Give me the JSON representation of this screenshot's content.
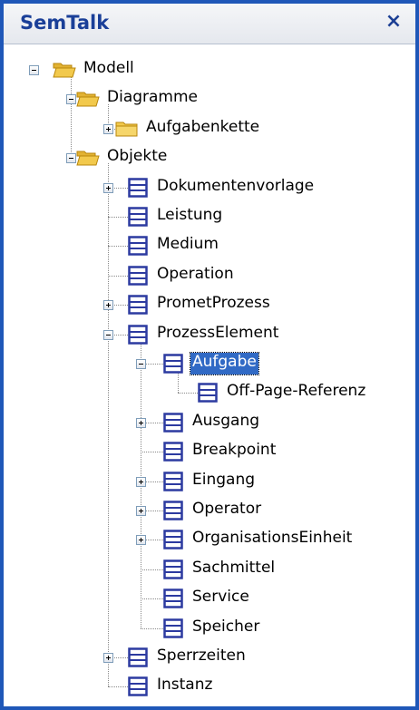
{
  "panel": {
    "title": "SemTalk",
    "close_glyph": "×"
  },
  "tree": {
    "nodes": [
      {
        "label": "Modell",
        "icon": "folder-open-icon",
        "expander": "minus"
      },
      {
        "label": "Diagramme",
        "icon": "folder-open-icon",
        "expander": "minus"
      },
      {
        "label": "Aufgabenkette",
        "icon": "folder-closed-icon",
        "expander": "plus"
      },
      {
        "label": "Objekte",
        "icon": "folder-open-icon",
        "expander": "minus"
      },
      {
        "label": "Dokumentenvorlage",
        "icon": "class-icon",
        "expander": "plus"
      },
      {
        "label": "Leistung",
        "icon": "class-icon",
        "expander": null
      },
      {
        "label": "Medium",
        "icon": "class-icon",
        "expander": null
      },
      {
        "label": "Operation",
        "icon": "class-icon",
        "expander": null
      },
      {
        "label": "PrometProzess",
        "icon": "class-icon",
        "expander": "plus"
      },
      {
        "label": "ProzessElement",
        "icon": "class-icon",
        "expander": "minus"
      },
      {
        "label": "Aufgabe",
        "icon": "class-icon",
        "expander": "minus",
        "selected": true
      },
      {
        "label": "Off-Page-Referenz",
        "icon": "class-icon",
        "expander": null
      },
      {
        "label": "Ausgang",
        "icon": "class-icon",
        "expander": "plus"
      },
      {
        "label": "Breakpoint",
        "icon": "class-icon",
        "expander": null
      },
      {
        "label": "Eingang",
        "icon": "class-icon",
        "expander": "plus"
      },
      {
        "label": "Operator",
        "icon": "class-icon",
        "expander": "plus"
      },
      {
        "label": "OrganisationsEinheit",
        "icon": "class-icon",
        "expander": "plus"
      },
      {
        "label": "Sachmittel",
        "icon": "class-icon",
        "expander": null
      },
      {
        "label": "Service",
        "icon": "class-icon",
        "expander": null
      },
      {
        "label": "Speicher",
        "icon": "class-icon",
        "expander": null
      },
      {
        "label": "Sperrzeiten",
        "icon": "class-icon",
        "expander": "plus"
      },
      {
        "label": "Instanz",
        "icon": "class-icon",
        "expander": null
      }
    ]
  },
  "colors": {
    "frame_border": "#1f57b8",
    "title_text": "#1a3f98",
    "selection": "#316ac5",
    "folder": "#f2c94c",
    "class_icon": "#2c3aa0"
  }
}
